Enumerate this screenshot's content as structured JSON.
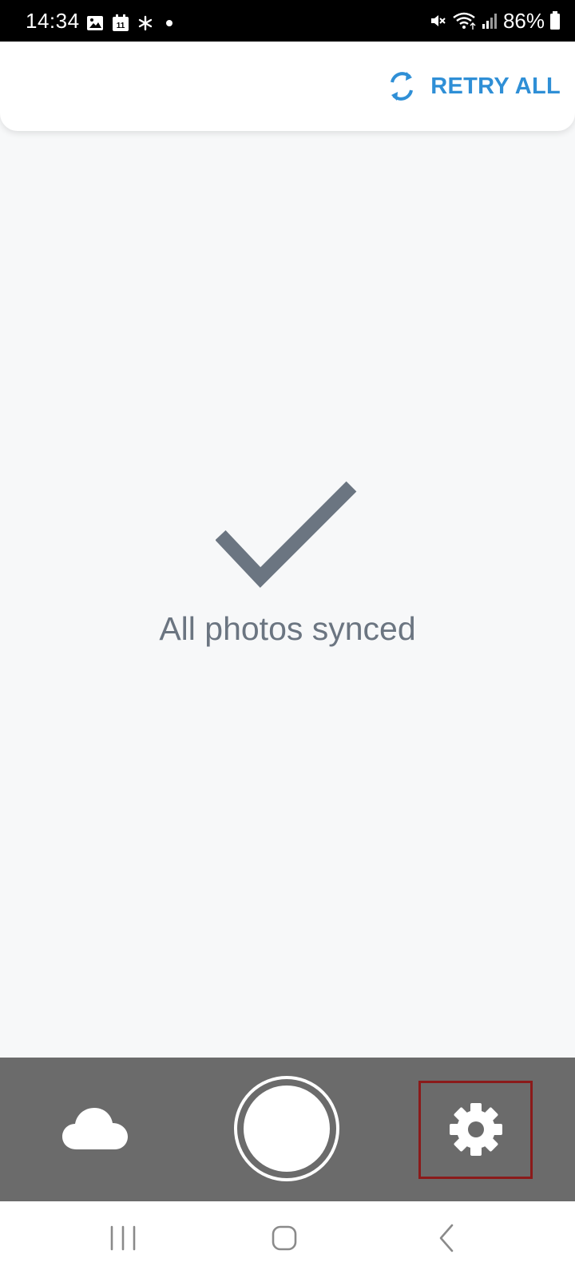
{
  "status_bar": {
    "time": "14:34",
    "battery": "86%",
    "left_icons": [
      "gallery-icon",
      "calendar-icon",
      "asterisk-icon",
      "dot-icon"
    ],
    "calendar_day": "11",
    "right_icons": [
      "mute-icon",
      "wifi-icon",
      "signal-icon",
      "battery-icon"
    ]
  },
  "top_bar": {
    "retry_icon": "sync-icon",
    "retry_label": "RETRY ALL"
  },
  "empty_state": {
    "icon": "checkmark-icon",
    "message": "All photos synced"
  },
  "action_bar": {
    "left_icon": "cloud-icon",
    "center": "shutter-button",
    "right_icon": "gear-icon"
  },
  "nav_bar": {
    "icons": [
      "recents-icon",
      "home-icon",
      "back-icon"
    ]
  },
  "colors": {
    "accent": "#2f8fd6",
    "check": "#6b7581",
    "message": "#6b7581",
    "action_bar": "#6b6b6b",
    "highlight": "#8b1a1a",
    "background": "#f7f8f9"
  }
}
